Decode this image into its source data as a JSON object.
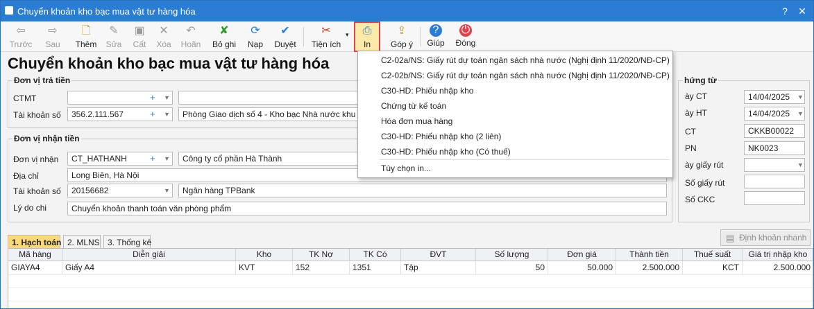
{
  "window": {
    "title": "Chuyển khoản kho bạc mua vật tư hàng hóa",
    "controls": {
      "help": "?",
      "close": "✕"
    }
  },
  "toolbar": {
    "prev": "Trước",
    "next": "Sau",
    "add": "Thêm",
    "edit": "Sửa",
    "cut": "Cất",
    "delete": "Xóa",
    "cancel": "Hoãn",
    "unpost": "Bỏ ghi",
    "reload": "Nạp",
    "approve": "Duyệt",
    "utilities": "Tiện ích",
    "print": "In",
    "feedback": "Góp ý",
    "help": "Giúp",
    "close": "Đóng"
  },
  "page_title": "Chuyển khoản kho bạc mua vật tư hàng hóa",
  "payer": {
    "legend": "Đơn vị trả tiền",
    "ctmt_label": "CTMT",
    "ctmt_value": "",
    "ctmt_name": "",
    "account_label": "Tài khoản số",
    "account_value": "356.2.111.567",
    "account_bank": "Phòng Giao dịch số 4 - Kho bạc Nhà nước khu vực I"
  },
  "payee": {
    "legend": "Đơn vị nhận tiền",
    "unit_label": "Đơn vị nhận",
    "unit_code": "CT_HATHANH",
    "unit_name": "Công ty cổ phần Hà Thành",
    "address_label": "Địa chỉ",
    "address_value": "Long Biên, Hà Nội",
    "account_label": "Tài khoản số",
    "account_value": "20156682",
    "bank_name": "Ngân hàng TPBank",
    "reason_label": "Lý do chi",
    "reason_value": "Chuyển khoản thanh toán văn phòng phẩm"
  },
  "voucher": {
    "legend": "hứng từ",
    "date_ct_label": "ày CT",
    "date_ct": "14/04/2025",
    "date_ht_label": "ày HT",
    "date_ht": "14/04/2025",
    "so_ct_label": "CT",
    "so_ct": "CKKB00022",
    "so_pn_label": "PN",
    "so_pn": "NK0023",
    "withdraw_date_label": "ày giấy rút",
    "withdraw_no_label": "Số giấy rút",
    "ckc_label": "Số CKC"
  },
  "print_menu": [
    "C2-02a/NS: Giấy rút dự toán ngân sách nhà nước (Nghị định 11/2020/NĐ-CP)",
    "C2-02b/NS: Giấy rút dự toán ngân sách nhà nước (Nghị định 11/2020/NĐ-CP)",
    "C30-HD: Phiếu nhập kho",
    "Chứng từ kế toán",
    "Hóa đơn mua hàng",
    "C30-HD: Phiếu nhập kho (2 liên)",
    "C30-HD: Phiếu nhập kho (Có thuế)",
    "Tùy chọn in..."
  ],
  "auto_entry_button": "Định khoản nhanh",
  "tabs": [
    "1. Hạch toán",
    "2. MLNS",
    "3. Thống kê"
  ],
  "grid": {
    "headers": [
      "Mã hàng",
      "Diễn giải",
      "Kho",
      "TK Nợ",
      "TK Có",
      "ĐVT",
      "Số lượng",
      "Đơn giá",
      "Thành tiền",
      "Thuế suất",
      "Giá trị nhập kho"
    ],
    "rows": [
      [
        "GIAYA4",
        "Giấy A4",
        "KVT",
        "152",
        "1351",
        "Tập",
        "50",
        "50.000",
        "2.500.000",
        "KCT",
        "2.500.000"
      ]
    ]
  }
}
